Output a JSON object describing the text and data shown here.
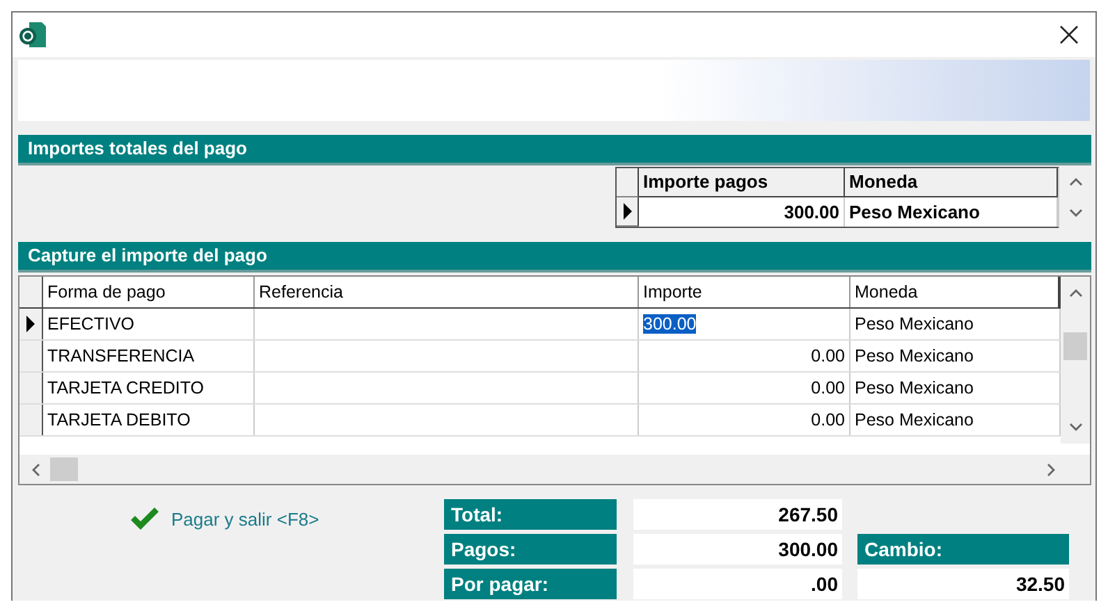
{
  "totals_section": {
    "title": "Importes totales del pago",
    "columns": [
      "Importe pagos",
      "Moneda"
    ],
    "rows": [
      {
        "amount": "300.00",
        "currency": "Peso Mexicano",
        "selected": true
      }
    ]
  },
  "capture_section": {
    "title": "Capture el importe del pago",
    "columns": [
      "Forma de pago",
      "Referencia",
      "Importe",
      "Moneda"
    ],
    "rows": [
      {
        "method": "EFECTIVO",
        "reference": "",
        "amount": "300.00",
        "currency": "Peso Mexicano",
        "selected": true
      },
      {
        "method": "TRANSFERENCIA",
        "reference": "",
        "amount": "0.00",
        "currency": "Peso Mexicano",
        "selected": false
      },
      {
        "method": "TARJETA CREDITO",
        "reference": "",
        "amount": "0.00",
        "currency": "Peso Mexicano",
        "selected": false
      },
      {
        "method": "TARJETA DEBITO",
        "reference": "",
        "amount": "0.00",
        "currency": "Peso Mexicano",
        "selected": false
      }
    ]
  },
  "pay_button": "Pagar y salir <F8>",
  "summary": [
    {
      "label": "Total:",
      "value": "267.50"
    },
    {
      "label": "Pagos:",
      "value": "300.00"
    },
    {
      "label": "Por pagar:",
      "value": ".00"
    }
  ],
  "change": {
    "label": "Cambio:",
    "value": "32.50"
  }
}
